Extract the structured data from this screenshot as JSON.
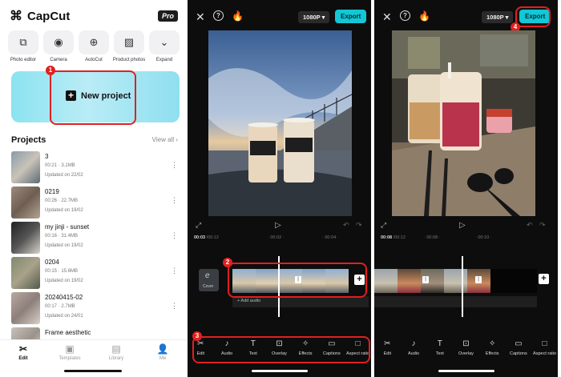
{
  "home": {
    "app_name": "CapCut",
    "pro_badge": "Pro",
    "tools": [
      {
        "label": "Photo editor",
        "icon": "photo-editor-icon",
        "glyph": "⧉"
      },
      {
        "label": "Camera",
        "icon": "camera-icon",
        "glyph": "◉"
      },
      {
        "label": "AutoCut",
        "icon": "autocut-icon",
        "glyph": "⊕"
      },
      {
        "label": "Product photos",
        "icon": "product-photos-icon",
        "glyph": "▨"
      },
      {
        "label": "Expand",
        "icon": "chevron-down-icon",
        "glyph": "⌄"
      }
    ],
    "new_project_label": "New project",
    "projects_heading": "Projects",
    "view_all": "View all",
    "projects": [
      {
        "title": "3",
        "meta": "00:21 · 3.1MB",
        "updated": "Updated on 22/02"
      },
      {
        "title": "0219",
        "meta": "00:26 · 22.7MB",
        "updated": "Updated on 19/02"
      },
      {
        "title": "my jinji - sunset",
        "meta": "00:16 · 31.4MB",
        "updated": "Updated on 19/02"
      },
      {
        "title": "0204",
        "meta": "00:15 · 15.6MB",
        "updated": "Updated on 19/02"
      },
      {
        "title": "20240415-02",
        "meta": "00:17 · 2.7MB",
        "updated": "Updated on 24/01"
      },
      {
        "title": "Frame aesthetic",
        "meta": "",
        "updated": ""
      }
    ],
    "nav": [
      {
        "label": "Edit",
        "icon": "scissors-icon",
        "glyph": "✂",
        "active": true
      },
      {
        "label": "Templates",
        "icon": "templates-icon",
        "glyph": "▣",
        "active": false
      },
      {
        "label": "Library",
        "icon": "library-icon",
        "glyph": "▤",
        "active": false
      },
      {
        "label": "Me",
        "icon": "profile-icon",
        "glyph": "👤",
        "active": false
      }
    ]
  },
  "editor": {
    "resolution": "1080P ▾",
    "export_label": "Export",
    "time_start": "00:03",
    "time_total": "00:12",
    "time_start_2": "00:08",
    "add_audio": "+ Add audio",
    "cover_label": "Cover",
    "tools": [
      {
        "label": "Edit",
        "icon": "scissors-icon",
        "glyph": "✂"
      },
      {
        "label": "Audio",
        "icon": "music-note-icon",
        "glyph": "♪"
      },
      {
        "label": "Text",
        "icon": "text-icon",
        "glyph": "T"
      },
      {
        "label": "Overlay",
        "icon": "overlay-icon",
        "glyph": "⊡"
      },
      {
        "label": "Effects",
        "icon": "effects-icon",
        "glyph": "✧"
      },
      {
        "label": "Captions",
        "icon": "captions-icon",
        "glyph": "▭"
      },
      {
        "label": "Aspect ratio",
        "icon": "aspect-ratio-icon",
        "glyph": "□"
      }
    ]
  },
  "annotations": [
    "1",
    "2",
    "3",
    "4"
  ],
  "colors": {
    "accent": "#12c7d6",
    "highlight": "#e0201f",
    "editor_bg": "#0d0d0d"
  }
}
